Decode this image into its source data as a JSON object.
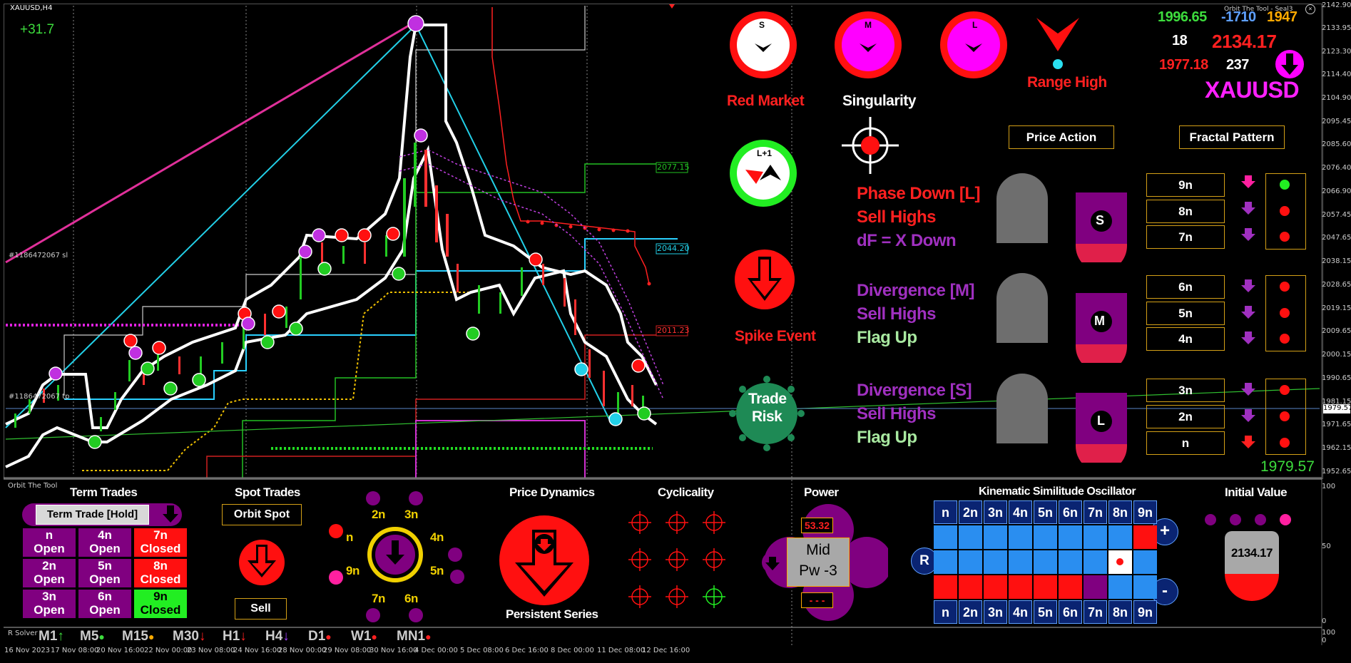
{
  "chart": {
    "symbol": "XAUUSD,H4",
    "profit": "+31.7",
    "order_label_1": "#1186472067 sl",
    "order_label_2": "#1186472067 tp",
    "price_labels": [
      "2077.15",
      "2044.20",
      "2011.23"
    ],
    "y_ticks": [
      "2142.90",
      "2133.95",
      "2123.30",
      "2114.40",
      "2104.90",
      "2095.45",
      "2085.60",
      "2076.40",
      "2066.90",
      "2057.45",
      "2047.65",
      "2038.15",
      "2028.65",
      "2019.15",
      "2009.65",
      "2000.15",
      "1990.65",
      "1981.15",
      "1971.65",
      "1962.15",
      "1952.65"
    ],
    "current_price_tag": "1979.57",
    "x_ticks": [
      "16 Nov 2023",
      "17 Nov 08:00",
      "20 Nov 16:00",
      "22 Nov 00:00",
      "23 Nov 08:00",
      "24 Nov 16:00",
      "28 Nov 00:00",
      "29 Nov 08:00",
      "30 Nov 16:00",
      "4 Dec 00:00",
      "5 Dec 08:00",
      "6 Dec 16:00",
      "8 Dec 00:00",
      "11 Dec 08:00",
      "12 Dec 16:00"
    ],
    "sub_ticks": [
      "100",
      "50",
      "0"
    ]
  },
  "panel": {
    "title": "Orbit The Tool - Seal3",
    "quotes": {
      "q1": "1996.65",
      "q2": "-1710",
      "q3": "1947",
      "q4": "18",
      "q5": "2134.17",
      "q6": "1977.18",
      "q7": "237"
    },
    "symbol_big": "XAUUSD",
    "dials": [
      {
        "letter": "S"
      },
      {
        "letter": "M"
      },
      {
        "letter": "L"
      }
    ],
    "range_high": "Range High",
    "red_market": "Red Market",
    "singularity": "Singularity",
    "l1_label": "L+1",
    "spike_event": "Spike Event",
    "trade_risk_1": "Trade",
    "trade_risk_2": "Risk",
    "price_action_btn": "Price Action",
    "fractal_pattern_btn": "Fractal Pattern",
    "groups": [
      {
        "l1": "Phase Down [L]",
        "l2": "Sell Highs",
        "l3": "dF = X Down",
        "badge": "S",
        "rows": [
          "9n",
          "8n",
          "7n"
        ]
      },
      {
        "l1": "Divergence [M]",
        "l2": "Sell Highs",
        "l3": "Flag Up",
        "badge": "M",
        "rows": [
          "6n",
          "5n",
          "4n"
        ]
      },
      {
        "l1": "Divergence [S]",
        "l2": "Sell Highs",
        "l3": "Flag Up",
        "badge": "L",
        "rows": [
          "3n",
          "2n",
          "n"
        ]
      }
    ],
    "last_price": "1979.57"
  },
  "bottom": {
    "app_name": "Orbit The Tool",
    "term_trades": "Term Trades",
    "term_trade_btn": "Term Trade [Hold]",
    "term_cells": [
      {
        "n": "n",
        "s": "Open"
      },
      {
        "n": "4n",
        "s": "Open"
      },
      {
        "n": "7n",
        "s": "Closed"
      },
      {
        "n": "2n",
        "s": "Open"
      },
      {
        "n": "5n",
        "s": "Open"
      },
      {
        "n": "8n",
        "s": "Closed"
      },
      {
        "n": "3n",
        "s": "Open"
      },
      {
        "n": "6n",
        "s": "Open"
      },
      {
        "n": "9n",
        "s": "Closed"
      }
    ],
    "spot_trades": "Spot Trades",
    "orbit_spot_btn": "Orbit Spot",
    "sell_btn": "Sell",
    "orbit_labels": [
      "2n",
      "3n",
      "4n",
      "5n",
      "6n",
      "7n",
      "9n",
      "n"
    ],
    "price_dynamics": "Price Dynamics",
    "persistent_series": "Persistent Series",
    "cyclicality": "Cyclicality",
    "power": "Power",
    "power_value": "53.32",
    "power_mid": "Mid",
    "power_pw": "Pw -3",
    "power_dash": "- - -",
    "kso_title": "Kinematic Similitude Oscillator",
    "kso_headers": [
      "n",
      "2n",
      "3n",
      "4n",
      "5n",
      "6n",
      "7n",
      "8n",
      "9n"
    ],
    "kso_r": "R",
    "kso_plus": "+",
    "kso_minus": "-",
    "initial_value": "Initial Value",
    "initial_value_num": "2134.17",
    "solver_label": "R Solver",
    "timeframes": [
      {
        "tf": "M1",
        "sym": "↑",
        "col": "#3ddc3d"
      },
      {
        "tf": "M5",
        "sym": "●",
        "col": "#3ddc3d"
      },
      {
        "tf": "M15",
        "sym": "●",
        "col": "#ffaa00"
      },
      {
        "tf": "M30",
        "sym": "↓",
        "col": "#ff2020"
      },
      {
        "tf": "H1",
        "sym": "↓",
        "col": "#ff2020"
      },
      {
        "tf": "H4",
        "sym": "↓",
        "col": "#a040ff"
      },
      {
        "tf": "D1",
        "sym": "●",
        "col": "#ff2020"
      },
      {
        "tf": "W1",
        "sym": "●",
        "col": "#ff2020"
      },
      {
        "tf": "MN1",
        "sym": "●",
        "col": "#ff2020"
      }
    ]
  }
}
